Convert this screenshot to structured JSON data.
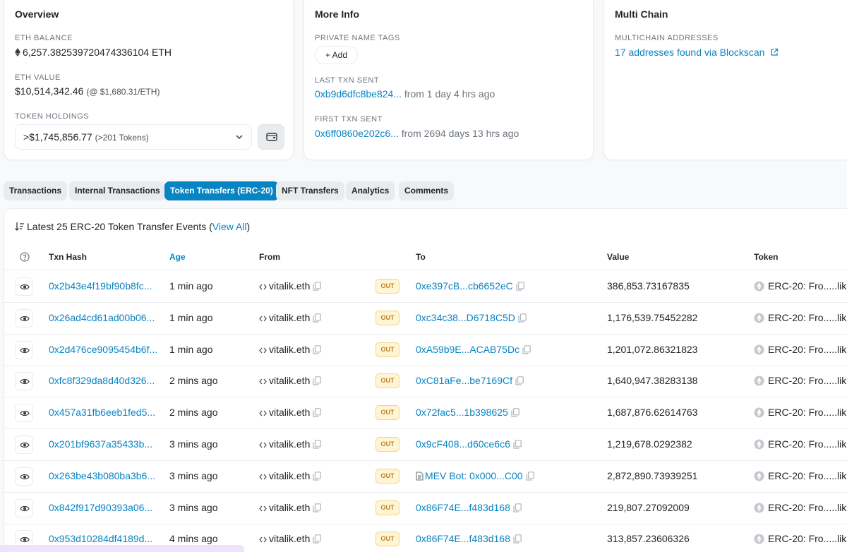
{
  "overview": {
    "title": "Overview",
    "eth_balance_label": "ETH BALANCE",
    "eth_balance": "6,257.382539720474336104 ETH",
    "eth_value_label": "ETH VALUE",
    "eth_value": "$10,514,342.46",
    "eth_price": "(@ $1,680.31/ETH)",
    "token_holdings_label": "TOKEN HOLDINGS",
    "token_holdings_value": ">$1,745,856.77",
    "token_holdings_count": "(>201 Tokens)"
  },
  "more_info": {
    "title": "More Info",
    "private_tags_label": "PRIVATE NAME TAGS",
    "add_label": "+ Add",
    "last_txn_label": "LAST TXN SENT",
    "last_txn_hash": "0xb9d6dfc8be824...",
    "last_txn_time": "from 1 day 4 hrs ago",
    "first_txn_label": "FIRST TXN SENT",
    "first_txn_hash": "0x6ff0860e202c6...",
    "first_txn_time": "from 2694 days 13 hrs ago"
  },
  "multi_chain": {
    "title": "Multi Chain",
    "addresses_label": "MULTICHAIN ADDRESSES",
    "addresses_link": "17 addresses found via Blockscan"
  },
  "tabs": [
    {
      "label": "Transactions",
      "active": false
    },
    {
      "label": "Internal Transactions",
      "active": false
    },
    {
      "label": "Token Transfers (ERC-20)",
      "active": true
    },
    {
      "label": "NFT Transfers",
      "active": false
    },
    {
      "label": "Analytics",
      "active": false
    },
    {
      "label": "Comments",
      "active": false
    }
  ],
  "table": {
    "summary": "Latest 25 ERC-20 Token Transfer Events (",
    "view_all": "View All",
    "summary_end": ")",
    "headers": {
      "txn_hash": "Txn Hash",
      "age": "Age",
      "from": "From",
      "to": "To",
      "value": "Value",
      "token": "Token"
    },
    "badge": "OUT",
    "rows": [
      {
        "hash": "0x2b43e4f19bf90b8fc...",
        "age": "1 min ago",
        "from": "vitalik.eth",
        "to": "0xe397cB...cb6652eC",
        "to_contract": false,
        "value": "386,853.73167835",
        "token": "ERC-20: Fro.....lik"
      },
      {
        "hash": "0x26ad4cd61ad00b06...",
        "age": "1 min ago",
        "from": "vitalik.eth",
        "to": "0xc34c38...D6718C5D",
        "to_contract": false,
        "value": "1,176,539.75452282",
        "token": "ERC-20: Fro.....lik"
      },
      {
        "hash": "0x2d476ce9095454b6f...",
        "age": "1 min ago",
        "from": "vitalik.eth",
        "to": "0xA59b9E...ACAB75Dc",
        "to_contract": false,
        "value": "1,201,072.86321823",
        "token": "ERC-20: Fro.....lik"
      },
      {
        "hash": "0xfc8f329da8d40d326...",
        "age": "2 mins ago",
        "from": "vitalik.eth",
        "to": "0xC81aFe...be7169Cf",
        "to_contract": false,
        "value": "1,640,947.38283138",
        "token": "ERC-20: Fro.....lik"
      },
      {
        "hash": "0x457a31fb6eeb1fed5...",
        "age": "2 mins ago",
        "from": "vitalik.eth",
        "to": "0x72fac5...1b398625",
        "to_contract": false,
        "value": "1,687,876.62614763",
        "token": "ERC-20: Fro.....lik"
      },
      {
        "hash": "0x201bf9637a35433b...",
        "age": "3 mins ago",
        "from": "vitalik.eth",
        "to": "0x9cF408...d60ce6c6",
        "to_contract": false,
        "value": "1,219,678.0292382",
        "token": "ERC-20: Fro.....lik"
      },
      {
        "hash": "0x263be43b080ba3b6...",
        "age": "3 mins ago",
        "from": "vitalik.eth",
        "to": "MEV Bot: 0x000...C00",
        "to_contract": true,
        "value": "2,872,890.73939251",
        "token": "ERC-20: Fro.....lik"
      },
      {
        "hash": "0x842f917d90393a06...",
        "age": "3 mins ago",
        "from": "vitalik.eth",
        "to": "0x86F74E...f483d168",
        "to_contract": false,
        "value": "219,807.27092009",
        "token": "ERC-20: Fro.....lik"
      },
      {
        "hash": "0x953d10284df4189d...",
        "age": "4 mins ago",
        "from": "vitalik.eth",
        "to": "0x86F74E...f483d168",
        "to_contract": false,
        "value": "313,857.23606326",
        "token": "ERC-20: Fro.....lik"
      }
    ]
  },
  "colors": {
    "link": "#0784c3",
    "active_tab": "#0784c3",
    "badge_bg": "#fff4d6",
    "badge_text": "#b7851b"
  }
}
